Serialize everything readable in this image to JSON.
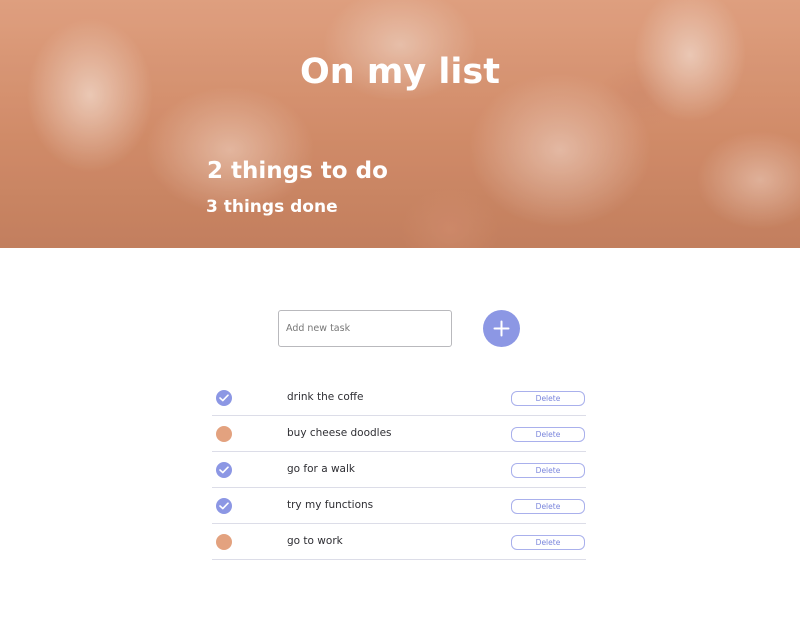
{
  "header": {
    "title": "On my list",
    "todo_count": "2 things to do",
    "done_count": "3 things done"
  },
  "add_task": {
    "placeholder": "Add new task",
    "value": "",
    "button_icon": "plus-icon"
  },
  "colors": {
    "accent": "#8c97e4",
    "pending": "#e3a27f",
    "hero": "#d9926d"
  },
  "tasks": [
    {
      "text": "drink the coffe",
      "done": true,
      "delete_label": "Delete"
    },
    {
      "text": "buy cheese doodles",
      "done": false,
      "delete_label": "Delete"
    },
    {
      "text": "go for a walk",
      "done": true,
      "delete_label": "Delete"
    },
    {
      "text": "try my functions",
      "done": true,
      "delete_label": "Delete"
    },
    {
      "text": "go to work",
      "done": false,
      "delete_label": "Delete"
    }
  ]
}
